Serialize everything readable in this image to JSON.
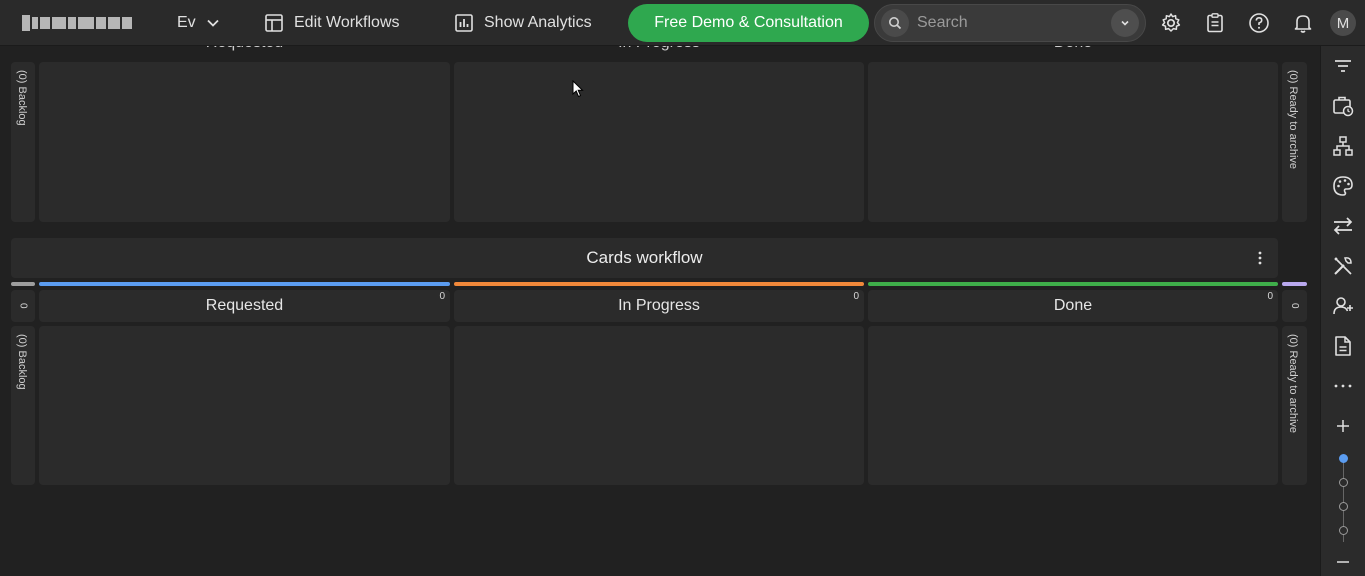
{
  "topbar": {
    "board_name": "Ev",
    "edit_workflows": "Edit Workflows",
    "show_analytics": "Show Analytics",
    "demo_button": "Free Demo & Consultation",
    "search_placeholder": "Search",
    "avatar_initial": "M"
  },
  "upper_workflow": {
    "columns": [
      "Requested",
      "In Progress",
      "Done"
    ],
    "backlog_label": "(0) Backlog",
    "archive_label": "(0) Ready to archive"
  },
  "cards_workflow": {
    "title": "Cards workflow",
    "backlog_count": "0",
    "archive_count": "0",
    "backlog_label": "(0) Backlog",
    "archive_label": "(0) Ready to archive",
    "columns": [
      {
        "name": "Requested",
        "count": "0",
        "color": "#5b9cf0"
      },
      {
        "name": "In Progress",
        "count": "0",
        "color": "#f0883a"
      },
      {
        "name": "Done",
        "count": "0",
        "color": "#3fae4a"
      }
    ],
    "backlog_color": "#9e9e9e",
    "archive_color": "#b9a8ee"
  },
  "colors": {
    "background": "#212121",
    "panel": "#2b2b2b",
    "accent_green": "#2fa84f"
  },
  "right_toolbar_icons": [
    "filter-icon",
    "calendar-clock-icon",
    "hierarchy-icon",
    "palette-icon",
    "swap-arrows-icon",
    "tools-icon",
    "add-user-icon",
    "document-icon",
    "more-icon",
    "zoom-in-icon",
    "zoom-out-icon"
  ]
}
